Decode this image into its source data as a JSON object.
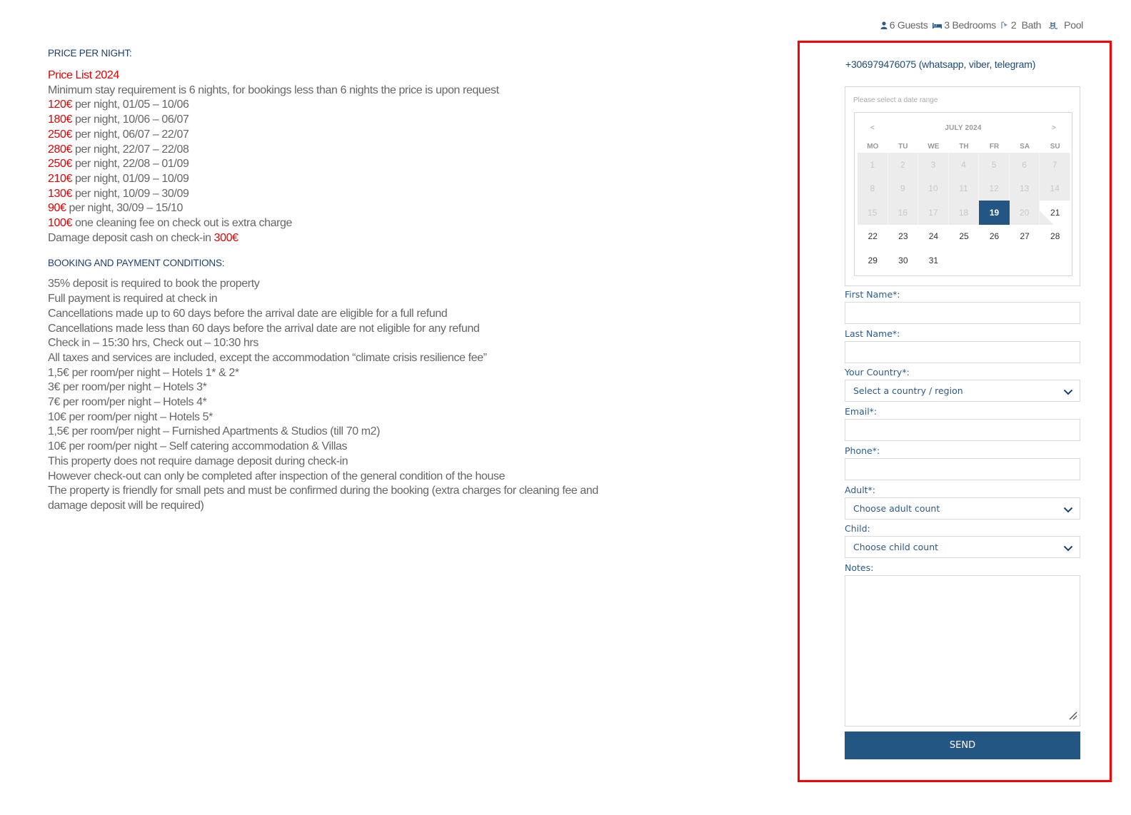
{
  "amenities": [
    {
      "icon": "guest-icon",
      "label": "6 Guests"
    },
    {
      "icon": "bed-icon",
      "label": "3 Bedrooms"
    },
    {
      "icon": "shower-icon",
      "label": "2  Bath"
    },
    {
      "icon": "pool-icon",
      "label": "Pool"
    }
  ],
  "pricing": {
    "title": "PRICE PER NIGHT:",
    "list_title": "Price List 2024",
    "min_stay": "Minimum stay requirement is 6 nights, for bookings less than 6 nights the price is upon request",
    "rates": [
      {
        "price": "120€",
        "text": " per night, 01/05 – 10/06"
      },
      {
        "price": "180€",
        "text": " per night, 10/06 – 06/07"
      },
      {
        "price": "250€",
        "text": " per night, 06/07 – 22/07"
      },
      {
        "price": "280€",
        "text": " per night, 22/07 – 22/08"
      },
      {
        "price": "250€",
        "text": " per night, 22/08 – 01/09"
      },
      {
        "price": "210€",
        "text": " per night, 01/09 – 10/09"
      },
      {
        "price": "130€",
        "text": " per night, 10/09 – 30/09"
      },
      {
        "price": "90€",
        "text": " per night, 30/09 – 15/10"
      }
    ],
    "cleaning": {
      "price": "100€",
      "text": " one cleaning fee on check out is extra charge"
    },
    "deposit": {
      "text": "Damage deposit cash on check-in ",
      "price": "300€"
    }
  },
  "conditions": {
    "title": "BOOKING AND PAYMENT CONDITIONS:",
    "lines": [
      "35% deposit is required to book the property",
      "Full payment is required at check in",
      "Cancellations made up to 60 days before the arrival date are eligible for a full refund",
      "Cancellations made less than 60 days before the arrival date are not eligible for any refund",
      "Check in – 15:30 hrs, Check out – 10:30 hrs",
      "All taxes and services are included, except the accommodation “climate crisis resilience fee”",
      "1,5€ per room/per night – Hotels 1* & 2*",
      "3€ per room/per night – Hotels 3*",
      "7€ per room/per night – Hotels 4*",
      "10€ per room/per night – Hotels 5*",
      "1,5€ per room/per night – Furnished Apartments & Studios (till 70 m2)",
      "10€ per room/per night – Self catering accommodation & Villas",
      "This property does not require damage deposit during check-in",
      "However check-out can only be completed after inspection of the general condition of the house",
      "The property is friendly for small pets and must be confirmed during the booking (extra charges for cleaning fee and damage deposit will be required)"
    ]
  },
  "booking": {
    "phone": "+306979476075 (whatsapp, viber, telegram)",
    "calendar": {
      "hint": "Please select a date range",
      "prev": "<",
      "next": ">",
      "month": "JULY 2024",
      "weekdays": [
        "MO",
        "TU",
        "WE",
        "TH",
        "FR",
        "SA",
        "SU"
      ],
      "days": 31,
      "first_weekday_offset": 0,
      "disabled_through": 20,
      "selected": 19
    },
    "fields": {
      "first_name": "First Name*:",
      "last_name": "Last Name*:",
      "country": "Your Country*:",
      "country_value": "Select a country / region",
      "email": "Email*:",
      "phone": "Phone*:",
      "adult": "Adult*:",
      "adult_value": "Choose adult count",
      "child": "Child:",
      "child_value": "Choose child count",
      "notes": "Notes:"
    },
    "send_label": "SEND"
  }
}
